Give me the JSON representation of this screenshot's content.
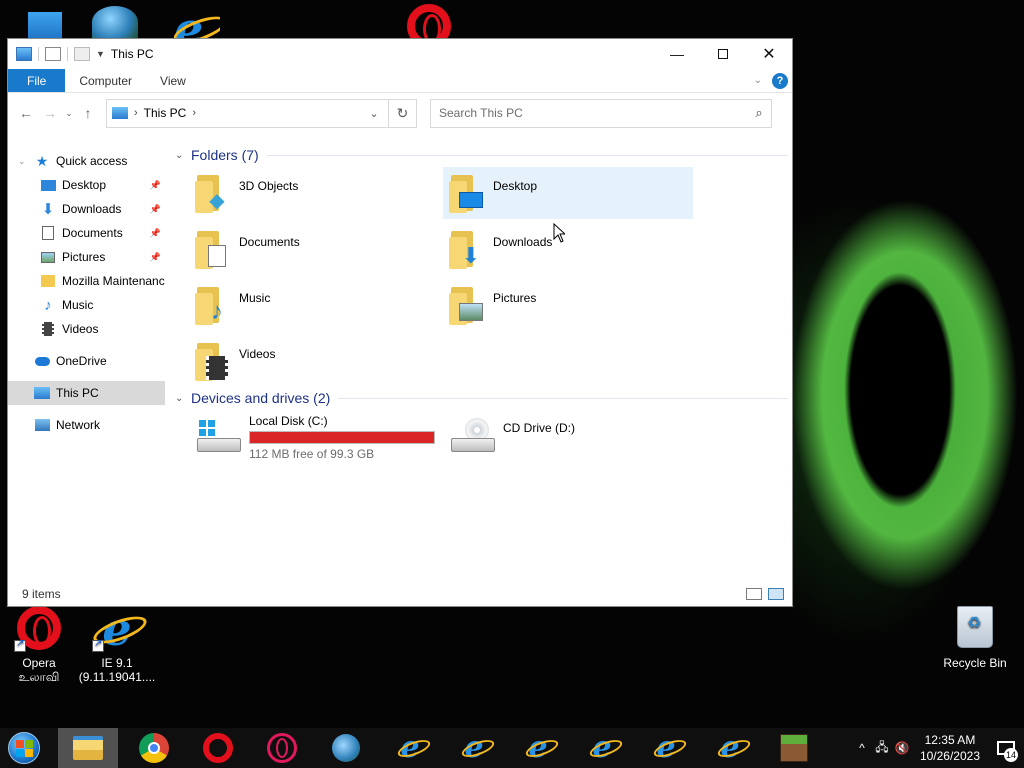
{
  "window": {
    "title": "This PC",
    "ribbon_tabs": [
      "File",
      "Computer",
      "View"
    ]
  },
  "address": {
    "path": "This PC",
    "search_placeholder": "Search This PC"
  },
  "navpane": {
    "quick_access": "Quick access",
    "pinned": [
      "Desktop",
      "Downloads",
      "Documents",
      "Pictures"
    ],
    "others": [
      "Mozilla Maintenanc",
      "Music",
      "Videos"
    ],
    "onedrive": "OneDrive",
    "this_pc": "This PC",
    "network": "Network"
  },
  "content": {
    "folders_header": "Folders (7)",
    "folders": [
      "3D Objects",
      "Desktop",
      "Documents",
      "Downloads",
      "Music",
      "Pictures",
      "Videos"
    ],
    "devices_header": "Devices and drives (2)",
    "drives": [
      {
        "name": "Local Disk (C:)",
        "free": "112 MB free of 99.3 GB",
        "used_fraction": 0.999
      },
      {
        "name": "CD Drive (D:)"
      }
    ]
  },
  "status": {
    "items": "9 items"
  },
  "desktop": {
    "opera_label_1": "Opera",
    "opera_label_2": "உலாவி",
    "ie_label_1": "IE 9.1",
    "ie_label_2": "(9.11.19041....",
    "recycle_bin": "Recycle Bin"
  },
  "taskbar": {
    "time": "12:35 AM",
    "date": "10/26/2023",
    "notification_count": "14"
  },
  "colors": {
    "accent": "#1979ca",
    "drive_bar": "#da2626",
    "selection": "#e5f1fb"
  }
}
